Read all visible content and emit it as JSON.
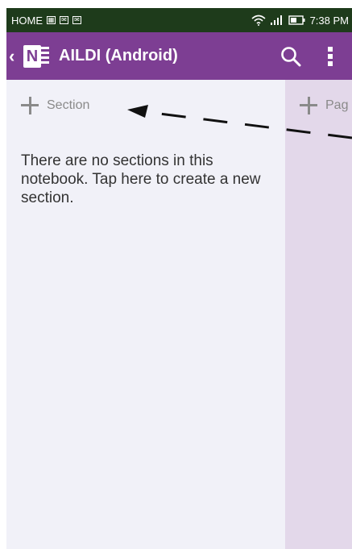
{
  "status_bar": {
    "carrier": "HOME",
    "icons": [
      "image-icon",
      "mail-icon",
      "mail-icon",
      "wifi-icon",
      "signal-icon",
      "battery-icon"
    ],
    "time": "7:38 PM"
  },
  "app_bar": {
    "logo_letter": "N",
    "title": "AILDI (Android)",
    "background": "#7d3e93"
  },
  "sections_pane": {
    "add_label": "Section",
    "empty_message": "There are no sections in this notebook. Tap here to create a new section."
  },
  "pages_pane": {
    "add_label": "Pag"
  },
  "colors": {
    "status_bar": "#1e3b1b",
    "app_bar": "#7d3e93",
    "sections_bg": "#f1f1f8",
    "pages_bg": "#e3d8ea"
  }
}
